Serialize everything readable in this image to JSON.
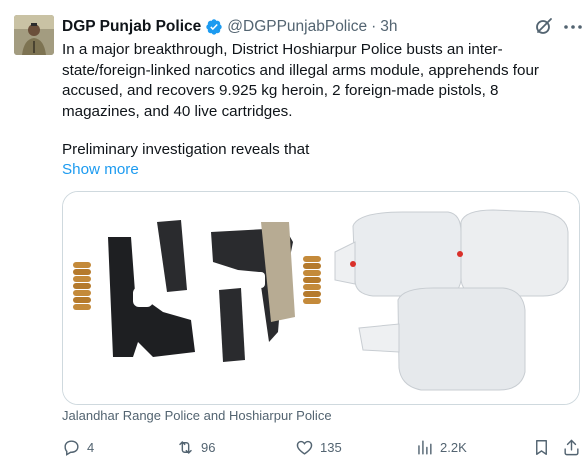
{
  "author": {
    "name": "DGP Punjab Police",
    "handle": "@DGPPunjabPolice",
    "separator": "·",
    "time": "3h"
  },
  "post": {
    "text": "In a major breakthrough, District Hoshiarpur Police busts an inter-state/foreign-linked narcotics and illegal arms module, apprehends four accused, and recovers 9.925 kg heroin, 2 foreign-made pistols, 8 magazines, and 40 live cartridges.",
    "text2": "Preliminary investigation reveals that",
    "show_more": "Show more"
  },
  "media": {
    "caption": "Jalandhar Range Police and Hoshiarpur Police"
  },
  "actions": {
    "replies": "4",
    "reposts": "96",
    "likes": "135",
    "views": "2.2K"
  },
  "colors": {
    "accent": "#1d9bf0",
    "secondary_text": "#536471",
    "verified": "#1d9bf0"
  }
}
